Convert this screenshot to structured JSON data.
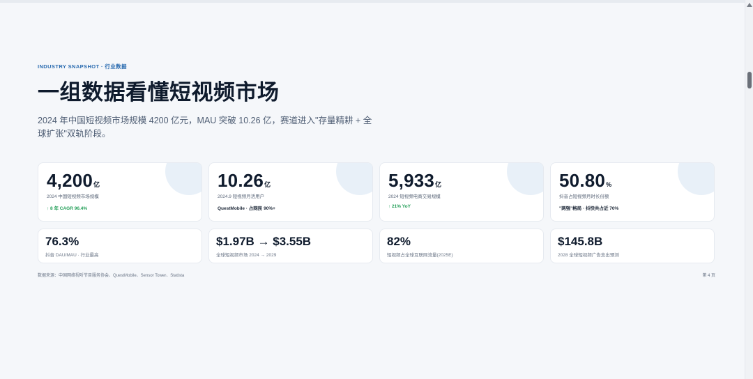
{
  "eyebrow": "INDUSTRY SNAPSHOT · 行业数据",
  "title": "一组数据看懂短视频市场",
  "subtitle": "2024 年中国短视频市场规模 4200 亿元，MAU 突破 10.26 亿，赛道进入\"存量精耕 + 全球扩张\"双轨阶段。",
  "big_cards": [
    {
      "value": "4,200",
      "unit": "亿",
      "label": "2024 中国短视频市场规模",
      "note": "↑ 8 年 CAGR 96.4%",
      "note_style": "green"
    },
    {
      "value": "10.26",
      "unit": "亿",
      "label": "2024.9 短视频月活用户",
      "note": "QuestMobile · 占网民 90%+",
      "note_style": "dark"
    },
    {
      "value": "5,933",
      "unit": "亿",
      "label": "2024 短视频电商交易规模",
      "note": "↑ 21% YoY",
      "note_style": "green"
    },
    {
      "value": "50.80",
      "unit": "%",
      "label": "抖音占短视频月时长份额",
      "note": "\"两强\"格局 · 抖快共占近 70%",
      "note_style": "dark"
    }
  ],
  "small_cards": [
    {
      "value": "76.3%",
      "label": "抖音 DAU/MAU · 行业最高"
    },
    {
      "value": "$1.97B → $3.55B",
      "label": "全球短视频市场 2024 → 2029"
    },
    {
      "value": "82%",
      "label": "短视频占全球互联网流量(2025E)"
    },
    {
      "value": "$145.8B",
      "label": "2028 全球短视频广告支出预测"
    }
  ],
  "source": "数据来源：中国网络视听节目服务协会、QuestMobile、Sensor Tower、Statista",
  "page_number": "第 4 页",
  "colors": {
    "accent": "#2b6cb0",
    "positive": "#1f9d55",
    "card_bg": "#ffffff",
    "page_bg": "#f5f7fa"
  }
}
